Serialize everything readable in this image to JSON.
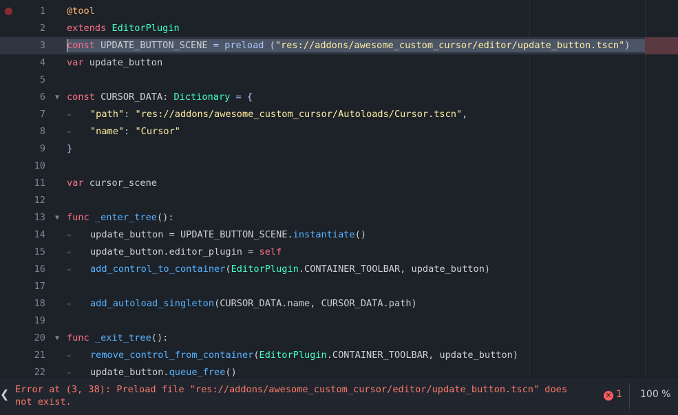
{
  "editor": {
    "lines": [
      {
        "n": "1",
        "breakpoint": true,
        "fold": false,
        "indent": false,
        "tokens": [
          {
            "t": "@tool",
            "c": "ann"
          }
        ]
      },
      {
        "n": "2",
        "fold": false,
        "indent": false,
        "tokens": [
          {
            "t": "extends ",
            "c": "kw"
          },
          {
            "t": "EditorPlugin",
            "c": "cls"
          }
        ]
      },
      {
        "n": "3",
        "current": true,
        "fold": false,
        "indent": false,
        "tokens": [
          {
            "t": "const",
            "c": "kw"
          },
          {
            "t": " UPDATE_BUTTON_SCENE ",
            "c": ""
          },
          {
            "t": "=",
            "c": "sym"
          },
          {
            "t": " ",
            "c": ""
          },
          {
            "t": "preload",
            "c": "kw2"
          },
          {
            "t": " (",
            "c": ""
          },
          {
            "t": "\"res://addons/awesome_custom_cursor/editor/update_button.tscn\"",
            "c": "str"
          },
          {
            "t": ")",
            "c": ""
          }
        ]
      },
      {
        "n": "4",
        "fold": false,
        "indent": false,
        "tokens": [
          {
            "t": "var",
            "c": "kw"
          },
          {
            "t": " update_button",
            "c": ""
          }
        ]
      },
      {
        "n": "5",
        "fold": false,
        "indent": false,
        "tokens": []
      },
      {
        "n": "6",
        "fold": true,
        "indent": false,
        "tokens": [
          {
            "t": "const",
            "c": "kw"
          },
          {
            "t": " CURSOR_DATA: ",
            "c": ""
          },
          {
            "t": "Dictionary",
            "c": "cls"
          },
          {
            "t": " = {",
            "c": "sym"
          }
        ]
      },
      {
        "n": "7",
        "fold": false,
        "indent": true,
        "tokens": [
          {
            "t": "\"path\"",
            "c": "str"
          },
          {
            "t": ": ",
            "c": ""
          },
          {
            "t": "\"res://addons/awesome_custom_cursor/Autoloads/Cursor.tscn\"",
            "c": "str"
          },
          {
            "t": ",",
            "c": ""
          }
        ]
      },
      {
        "n": "8",
        "fold": false,
        "indent": true,
        "tokens": [
          {
            "t": "\"name\"",
            "c": "str"
          },
          {
            "t": ": ",
            "c": ""
          },
          {
            "t": "\"Cursor\"",
            "c": "str"
          }
        ]
      },
      {
        "n": "9",
        "fold": false,
        "indent": false,
        "tokens": [
          {
            "t": "}",
            "c": "sym"
          }
        ]
      },
      {
        "n": "10",
        "fold": false,
        "indent": false,
        "tokens": []
      },
      {
        "n": "11",
        "fold": false,
        "indent": false,
        "tokens": [
          {
            "t": "var",
            "c": "kw"
          },
          {
            "t": " cursor_scene",
            "c": ""
          }
        ]
      },
      {
        "n": "12",
        "fold": false,
        "indent": false,
        "tokens": []
      },
      {
        "n": "13",
        "fold": true,
        "indent": false,
        "tokens": [
          {
            "t": "func",
            "c": "kw"
          },
          {
            "t": " ",
            "c": ""
          },
          {
            "t": "_enter_tree",
            "c": "fn"
          },
          {
            "t": "():",
            "c": ""
          }
        ]
      },
      {
        "n": "14",
        "fold": false,
        "indent": true,
        "tokens": [
          {
            "t": "update_button = UPDATE_BUTTON_SCENE.",
            "c": ""
          },
          {
            "t": "instantiate",
            "c": "fn"
          },
          {
            "t": "()",
            "c": ""
          }
        ]
      },
      {
        "n": "15",
        "fold": false,
        "indent": true,
        "tokens": [
          {
            "t": "update_button.editor_plugin = ",
            "c": ""
          },
          {
            "t": "self",
            "c": "kw"
          }
        ]
      },
      {
        "n": "16",
        "fold": false,
        "indent": true,
        "tokens": [
          {
            "t": "add_control_to_container",
            "c": "fn"
          },
          {
            "t": "(",
            "c": ""
          },
          {
            "t": "EditorPlugin",
            "c": "cls"
          },
          {
            "t": ".CONTAINER_TOOLBAR, update_button)",
            "c": ""
          }
        ]
      },
      {
        "n": "17",
        "fold": false,
        "indent": false,
        "tokens": []
      },
      {
        "n": "18",
        "fold": false,
        "indent": true,
        "tokens": [
          {
            "t": "add_autoload_singleton",
            "c": "fn"
          },
          {
            "t": "(CURSOR_DATA.name, CURSOR_DATA.path)",
            "c": ""
          }
        ]
      },
      {
        "n": "19",
        "fold": false,
        "indent": false,
        "tokens": []
      },
      {
        "n": "20",
        "fold": true,
        "indent": false,
        "tokens": [
          {
            "t": "func",
            "c": "kw"
          },
          {
            "t": " ",
            "c": ""
          },
          {
            "t": "_exit_tree",
            "c": "fn"
          },
          {
            "t": "():",
            "c": ""
          }
        ]
      },
      {
        "n": "21",
        "fold": false,
        "indent": true,
        "tokens": [
          {
            "t": "remove_control_from_container",
            "c": "fn"
          },
          {
            "t": "(",
            "c": ""
          },
          {
            "t": "EditorPlugin",
            "c": "cls"
          },
          {
            "t": ".CONTAINER_TOOLBAR, update_button)",
            "c": ""
          }
        ]
      },
      {
        "n": "22",
        "fold": false,
        "indent": true,
        "tokens": [
          {
            "t": "update_button.",
            "c": ""
          },
          {
            "t": "queue_free",
            "c": "fn"
          },
          {
            "t": "()",
            "c": ""
          }
        ]
      }
    ]
  },
  "status": {
    "arrow": "❮",
    "message": "Error at (3, 38): Preload file \"res://addons/awesome_custom_cursor/editor/update_button.tscn\" does not exist.",
    "error_icon": "close-circle-icon",
    "error_count": "1",
    "zoom": "100 %"
  },
  "colors": {
    "background": "#1d2229",
    "keyword": "#ff7085",
    "annotation": "#ffb373",
    "class": "#42ffc2",
    "string": "#ffeda1",
    "function": "#57b3ff",
    "error": "#ff786b"
  }
}
